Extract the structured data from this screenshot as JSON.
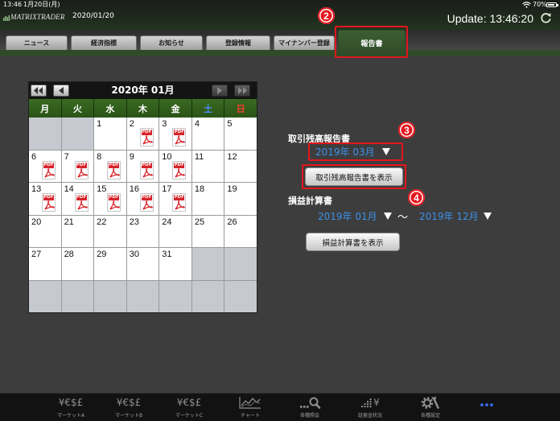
{
  "status_bar": {
    "time": "13:46",
    "date": "1月20日(月)",
    "battery": "70%",
    "wifi_icon": "wifi-icon",
    "battery_icon": "battery-icon"
  },
  "header": {
    "logo": "MATRIXTRADER",
    "date": "2020/01/20",
    "update": "Update: 13:46:20",
    "refresh_icon": "refresh-icon"
  },
  "tabs": [
    {
      "label": "ニュース"
    },
    {
      "label": "経済指標"
    },
    {
      "label": "お知らせ"
    },
    {
      "label": "登録情報"
    },
    {
      "label": "マイナンバー登録"
    },
    {
      "label": "報告書",
      "active": true
    }
  ],
  "calendar": {
    "title": "2020年 01月",
    "nav_icons": [
      "first-icon",
      "prev-icon",
      "next-icon",
      "last-icon"
    ],
    "weekdays": [
      "月",
      "火",
      "水",
      "木",
      "金",
      "土",
      "日"
    ],
    "weeks": [
      [
        null,
        null,
        1,
        2,
        3,
        4,
        5
      ],
      [
        6,
        7,
        8,
        9,
        10,
        11,
        12
      ],
      [
        13,
        14,
        15,
        16,
        17,
        18,
        19
      ],
      [
        20,
        21,
        22,
        23,
        24,
        25,
        26
      ],
      [
        27,
        28,
        29,
        30,
        31,
        null,
        null
      ],
      [
        null,
        null,
        null,
        null,
        null,
        null,
        null
      ]
    ],
    "report_days": [
      2,
      3,
      6,
      7,
      8,
      9,
      10,
      13,
      14,
      15,
      16,
      17
    ],
    "pdf_icon": {
      "icon": "pdf-icon",
      "label": "PDF"
    }
  },
  "balance_report": {
    "label": "取引残高報告書",
    "selected_month": "2019年 03月",
    "button": "取引残高報告書を表示"
  },
  "pl_statement": {
    "label": "損益計算書",
    "from_month": "2019年 01月",
    "separator": "〜",
    "to_month": "2019年 12月",
    "button": "損益計算書を表示"
  },
  "annotations": [
    "2",
    "3",
    "4"
  ],
  "tab_bar": [
    {
      "label": "マーケットA",
      "icon": "currency-icon",
      "icon_text": "¥€$£"
    },
    {
      "label": "マーケットB",
      "icon": "currency-icon",
      "icon_text": "¥€$£"
    },
    {
      "label": "マーケットC",
      "icon": "currency-icon",
      "icon_text": "¥€$£"
    },
    {
      "label": "チャート",
      "icon": "line-chart-icon"
    },
    {
      "label": "各種照会",
      "icon": "search-icon"
    },
    {
      "label": "証拠金状況",
      "icon": "bar-chart-yen-icon",
      "icon_text": "¥"
    },
    {
      "label": "各種設定",
      "icon": "gear-wrench-icon"
    },
    {
      "icon": "more-icon",
      "active": true
    }
  ],
  "colors": {
    "header_green": "#2f4b27",
    "weekday_green": "#2a5417",
    "month_blue": "#3d90ea",
    "saturday": "#4a8dff",
    "sunday": "#ff3b2f",
    "annotation_red": "#e3161d",
    "more_blue": "#3a6df0"
  }
}
